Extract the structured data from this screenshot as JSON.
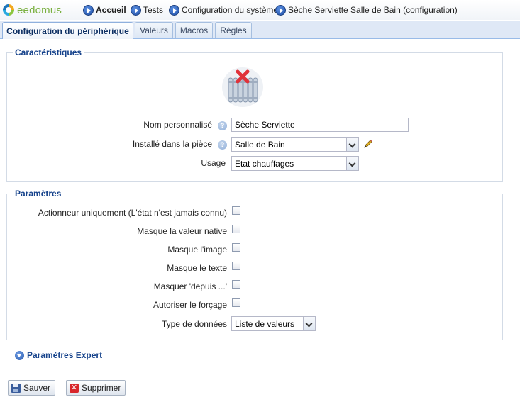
{
  "app": {
    "logo_text": "eedomus"
  },
  "breadcrumb": [
    {
      "label": "Accueil",
      "bold": true
    },
    {
      "label": "Tests"
    },
    {
      "label": "Configuration du système"
    },
    {
      "label": "Sèche Serviette Salle de Bain (configuration)"
    }
  ],
  "tabs": [
    {
      "label": "Configuration du périphérique",
      "active": true
    },
    {
      "label": "Valeurs"
    },
    {
      "label": "Macros"
    },
    {
      "label": "Règles"
    }
  ],
  "characteristics": {
    "legend": "Caractéristiques",
    "device_icon": "radiator-icon",
    "name_label": "Nom personnalisé",
    "name_value": "Sèche Serviette",
    "room_label": "Installé dans la pièce",
    "room_value": "Salle de Bain",
    "usage_label": "Usage",
    "usage_value": "Etat chauffages"
  },
  "parameters": {
    "legend": "Paramètres",
    "checkboxes": [
      {
        "label": "Actionneur uniquement (L'état n'est jamais connu)",
        "checked": false
      },
      {
        "label": "Masque la valeur native",
        "checked": false
      },
      {
        "label": "Masque l'image",
        "checked": false
      },
      {
        "label": "Masque le texte",
        "checked": false
      },
      {
        "label": "Masquer 'depuis ...'",
        "checked": false
      },
      {
        "label": "Autoriser le forçage",
        "checked": false
      }
    ],
    "data_type_label": "Type de données",
    "data_type_value": "Liste de valeurs"
  },
  "expert": {
    "legend": "Paramètres Expert"
  },
  "actions": {
    "save_label": "Sauver",
    "delete_label": "Supprimer"
  },
  "colors": {
    "accent": "#15428b",
    "tab_bar": "#dfe8f6",
    "delete": "#d8262b"
  }
}
